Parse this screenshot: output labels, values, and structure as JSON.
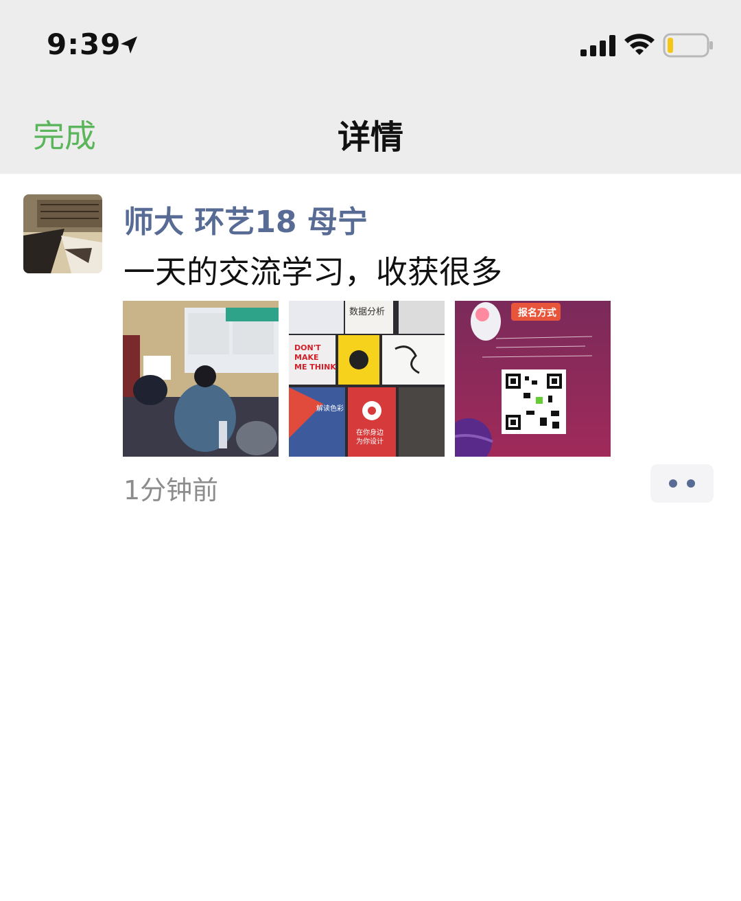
{
  "status_bar": {
    "time": "9:39",
    "icons": [
      "location-arrow-icon",
      "cellular-signal-icon",
      "wifi-icon",
      "battery-icon"
    ],
    "battery_level": 0.12,
    "battery_color": "#f5c518"
  },
  "nav": {
    "done_label": "完成",
    "title": "详情",
    "done_color": "#5bb55b"
  },
  "post": {
    "author": "师大 环艺18 母宁",
    "author_color": "#576b95",
    "text": "一天的交流学习，收获很多",
    "timestamp": "1分钟前",
    "photos": [
      {
        "name": "classroom-photo"
      },
      {
        "name": "books-photo",
        "visible_text": [
          "数据分析",
          "DON'T MAKE ME THINK",
          "在你身边 为你设计",
          "解读色彩"
        ]
      },
      {
        "name": "signup-poster",
        "visible_text": [
          "报名方式"
        ]
      }
    ],
    "more_icon": "more-dots-icon"
  }
}
